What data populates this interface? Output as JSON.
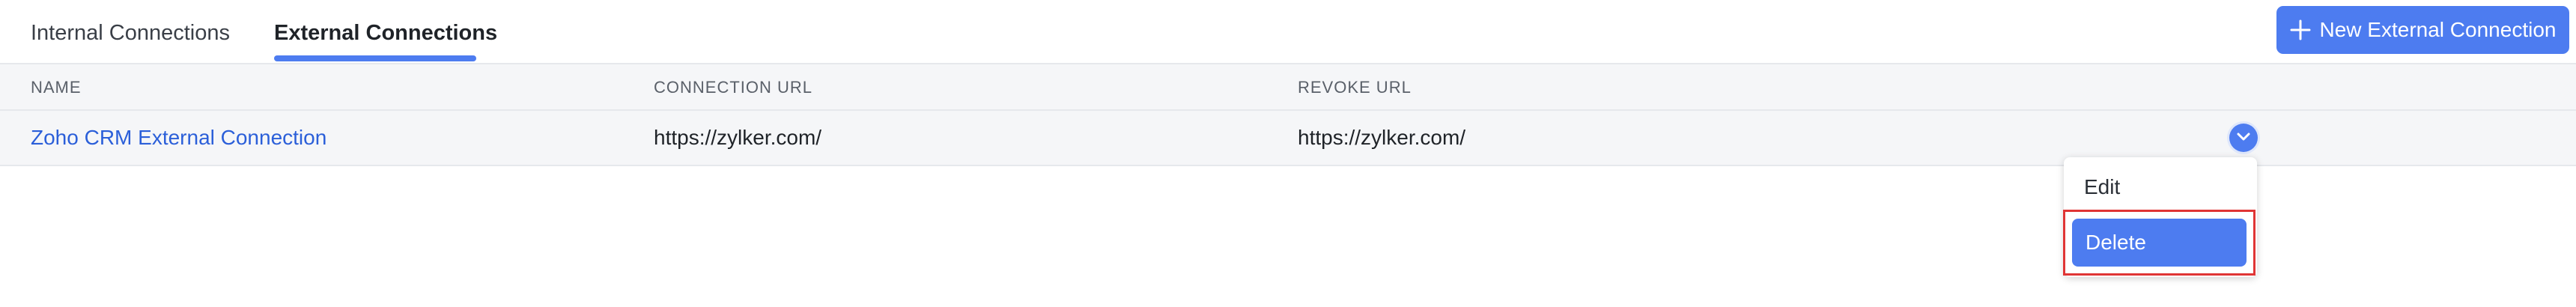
{
  "tabs": [
    {
      "label": "Internal Connections",
      "active": false
    },
    {
      "label": "External Connections",
      "active": true
    }
  ],
  "toolbar": {
    "new_connection_label": "New External Connection"
  },
  "table": {
    "columns": [
      "NAME",
      "CONNECTION URL",
      "REVOKE URL"
    ],
    "rows": [
      {
        "name": "Zoho CRM External Connection",
        "connection_url": "https://zylker.com/",
        "revoke_url": "https://zylker.com/"
      }
    ]
  },
  "row_menu": {
    "items": [
      "Edit",
      "Delete"
    ],
    "highlighted": "Delete"
  },
  "colors": {
    "accent": "#4d7cf0",
    "link": "#2b5fd9",
    "highlight_border": "#e03535"
  }
}
